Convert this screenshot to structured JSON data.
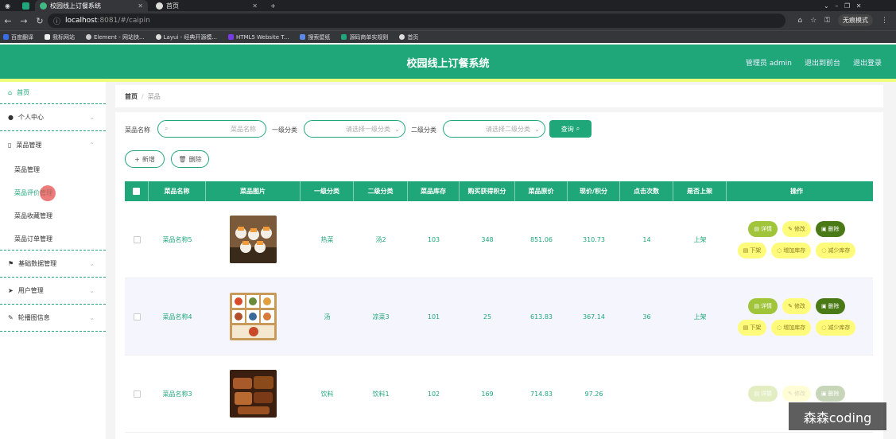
{
  "browser": {
    "tabs": [
      {
        "label": "校园线上订餐系统",
        "active": true
      },
      {
        "label": "首页",
        "active": false
      }
    ],
    "url_host": "localhost",
    "url_port": ":8081",
    "url_path": "/#/caipin",
    "incognito_label": "无痕模式",
    "bookmarks": [
      "百度翻译",
      "我标网站",
      "Element - 网站快...",
      "Layui - 经典开源模...",
      "HTML5 Website T...",
      "搜索壁纸",
      "源码商单实规则",
      "首页"
    ]
  },
  "header": {
    "title": "校园线上订餐系统",
    "admin_label": "管理员 admin",
    "back_label": "退出到前台",
    "logout_label": "退出登录"
  },
  "sidebar": {
    "home": "首页",
    "personal": "个人中心",
    "dish_mgmt": "菜品管理",
    "sub": [
      "菜品管理",
      "菜品评价管理",
      "菜品收藏管理",
      "菜品订单管理"
    ],
    "basic_data": "基础数据管理",
    "user_mgmt": "用户管理",
    "carousel": "轮播图信息"
  },
  "breadcrumb": {
    "home": "首页",
    "sep": "/",
    "current": "菜品"
  },
  "search": {
    "name_label": "菜品名称",
    "name_placeholder": "菜品名称",
    "cat1_label": "一级分类",
    "cat1_placeholder": "请选择一级分类",
    "cat2_label": "二级分类",
    "cat2_placeholder": "请选择二级分类",
    "query_btn": "查询",
    "add_btn": "新增",
    "delete_btn": "删除"
  },
  "table": {
    "headers": [
      "菜品名称",
      "菜品图片",
      "一级分类",
      "二级分类",
      "菜品库存",
      "购买获得积分",
      "菜品原价",
      "现价/积分",
      "点击次数",
      "是否上架",
      "操作"
    ],
    "rows": [
      {
        "name": "菜品名称5",
        "cat1": "热菜",
        "cat2": "汤2",
        "stock": "103",
        "points": "348",
        "orig": "851.06",
        "price": "310.73",
        "clicks": "14",
        "status": "上架"
      },
      {
        "name": "菜品名称4",
        "cat1": "汤",
        "cat2": "凉菜3",
        "stock": "101",
        "points": "25",
        "orig": "613.83",
        "price": "367.14",
        "clicks": "36",
        "status": "上架"
      },
      {
        "name": "菜品名称3",
        "cat1": "饮料",
        "cat2": "饮料1",
        "stock": "102",
        "points": "169",
        "orig": "714.83",
        "price": "97.26",
        "clicks": "",
        "status": ""
      }
    ],
    "ops": {
      "detail": "详情",
      "edit": "修改",
      "del": "删除",
      "off": "下架",
      "add_stock": "增加库存",
      "reduce_stock": "减少库存"
    }
  },
  "watermark": "森森coding",
  "colors": {
    "primary": "#1fa77a",
    "accent_line": "#eefe7a",
    "op_yellow": "#fffb7a",
    "op_green": "#a0c43a",
    "op_dark": "#4a7a16"
  }
}
